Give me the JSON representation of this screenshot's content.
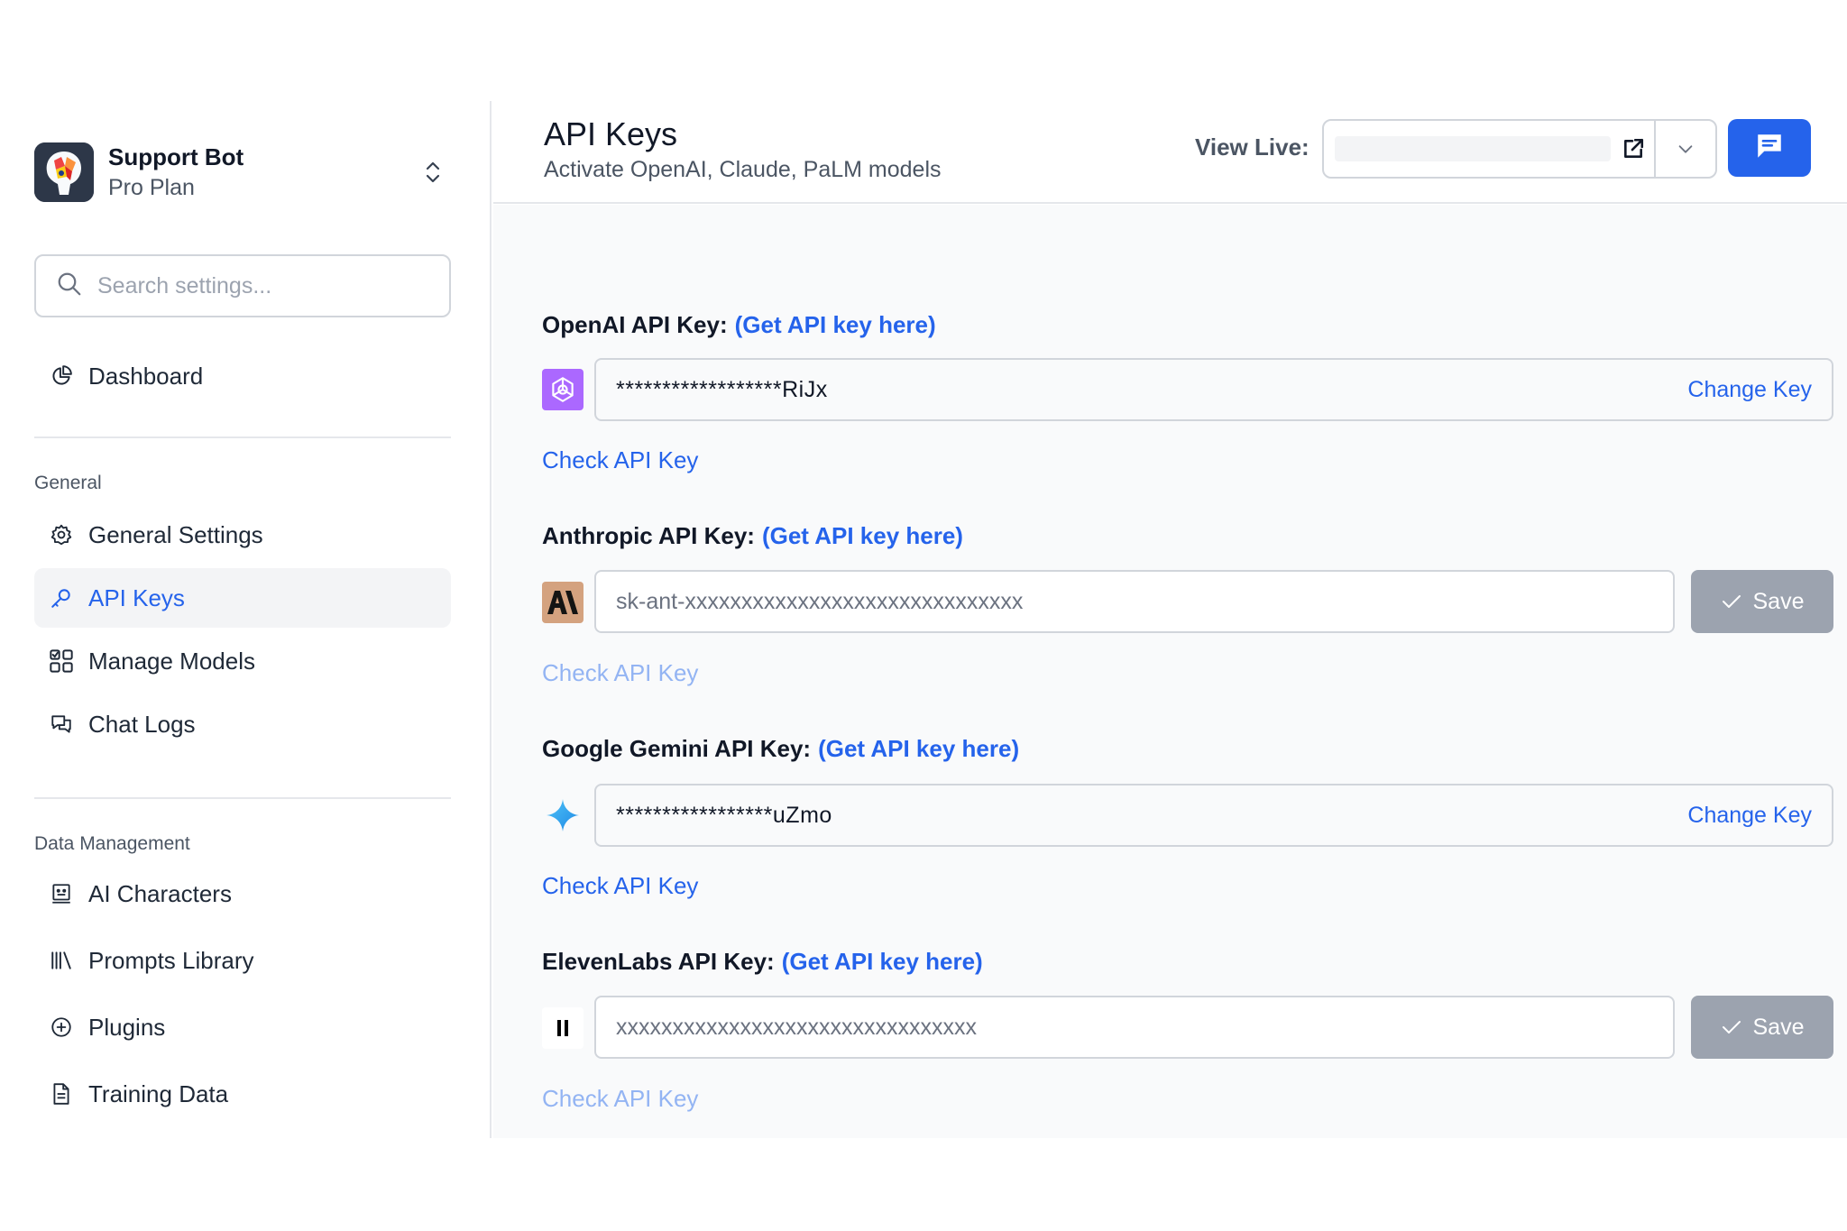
{
  "workspace": {
    "name": "Support Bot",
    "plan": "Pro Plan"
  },
  "search": {
    "placeholder": "Search settings..."
  },
  "nav": {
    "dashboard": "Dashboard",
    "general_label": "General",
    "general_settings": "General Settings",
    "api_keys": "API Keys",
    "manage_models": "Manage Models",
    "chat_logs": "Chat Logs",
    "data_label": "Data Management",
    "ai_characters": "AI Characters",
    "prompts_library": "Prompts Library",
    "plugins": "Plugins",
    "training_data": "Training Data"
  },
  "header": {
    "title": "API Keys",
    "subtitle": "Activate OpenAI, Claude, PaLM models",
    "view_live_label": "View Live:"
  },
  "keys": {
    "get_link": "(Get API key here)",
    "check_label": "Check API Key",
    "change_label": "Change Key",
    "save_label": "Save",
    "openai": {
      "label": "OpenAI API Key:",
      "value": "******************RiJx"
    },
    "anthropic": {
      "label": "Anthropic API Key:",
      "placeholder": "sk-ant-xxxxxxxxxxxxxxxxxxxxxxxxxxxxxx"
    },
    "gemini": {
      "label": "Google Gemini API Key:",
      "value": "*****************uZmo"
    },
    "elevenlabs": {
      "label": "ElevenLabs API Key:",
      "placeholder": "xxxxxxxxxxxxxxxxxxxxxxxxxxxxxxxx"
    }
  },
  "colors": {
    "accent": "#2563eb",
    "disabled": "#9ca3af"
  }
}
